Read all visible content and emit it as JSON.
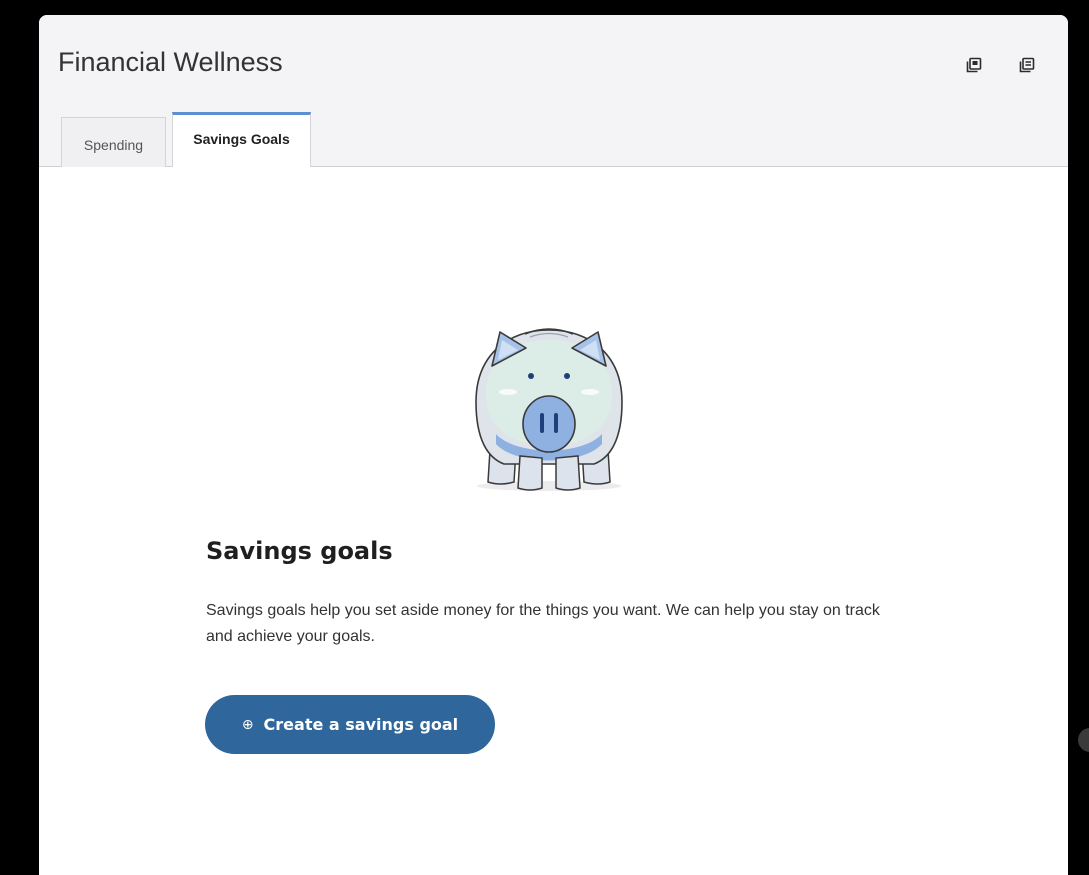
{
  "widget": {
    "title": "Financial Wellness",
    "header_icons": [
      "open-in-window-icon",
      "notes-icon"
    ]
  },
  "tabs": [
    {
      "label": "Spending",
      "selected": false
    },
    {
      "label": "Savings Goals",
      "selected": true
    }
  ],
  "empty_state": {
    "illustration": "piggy-bank-icon",
    "heading": "Savings goals",
    "description": "Savings goals help you set aside money for the things you want. We can help you stay on track and achieve your goals.",
    "cta_icon": "⊕",
    "cta_label": "Create a savings goal"
  },
  "colors": {
    "accent": "#2f669b",
    "tab_indicator": "#5b8fcf",
    "header_bg": "#f4f4f6"
  }
}
